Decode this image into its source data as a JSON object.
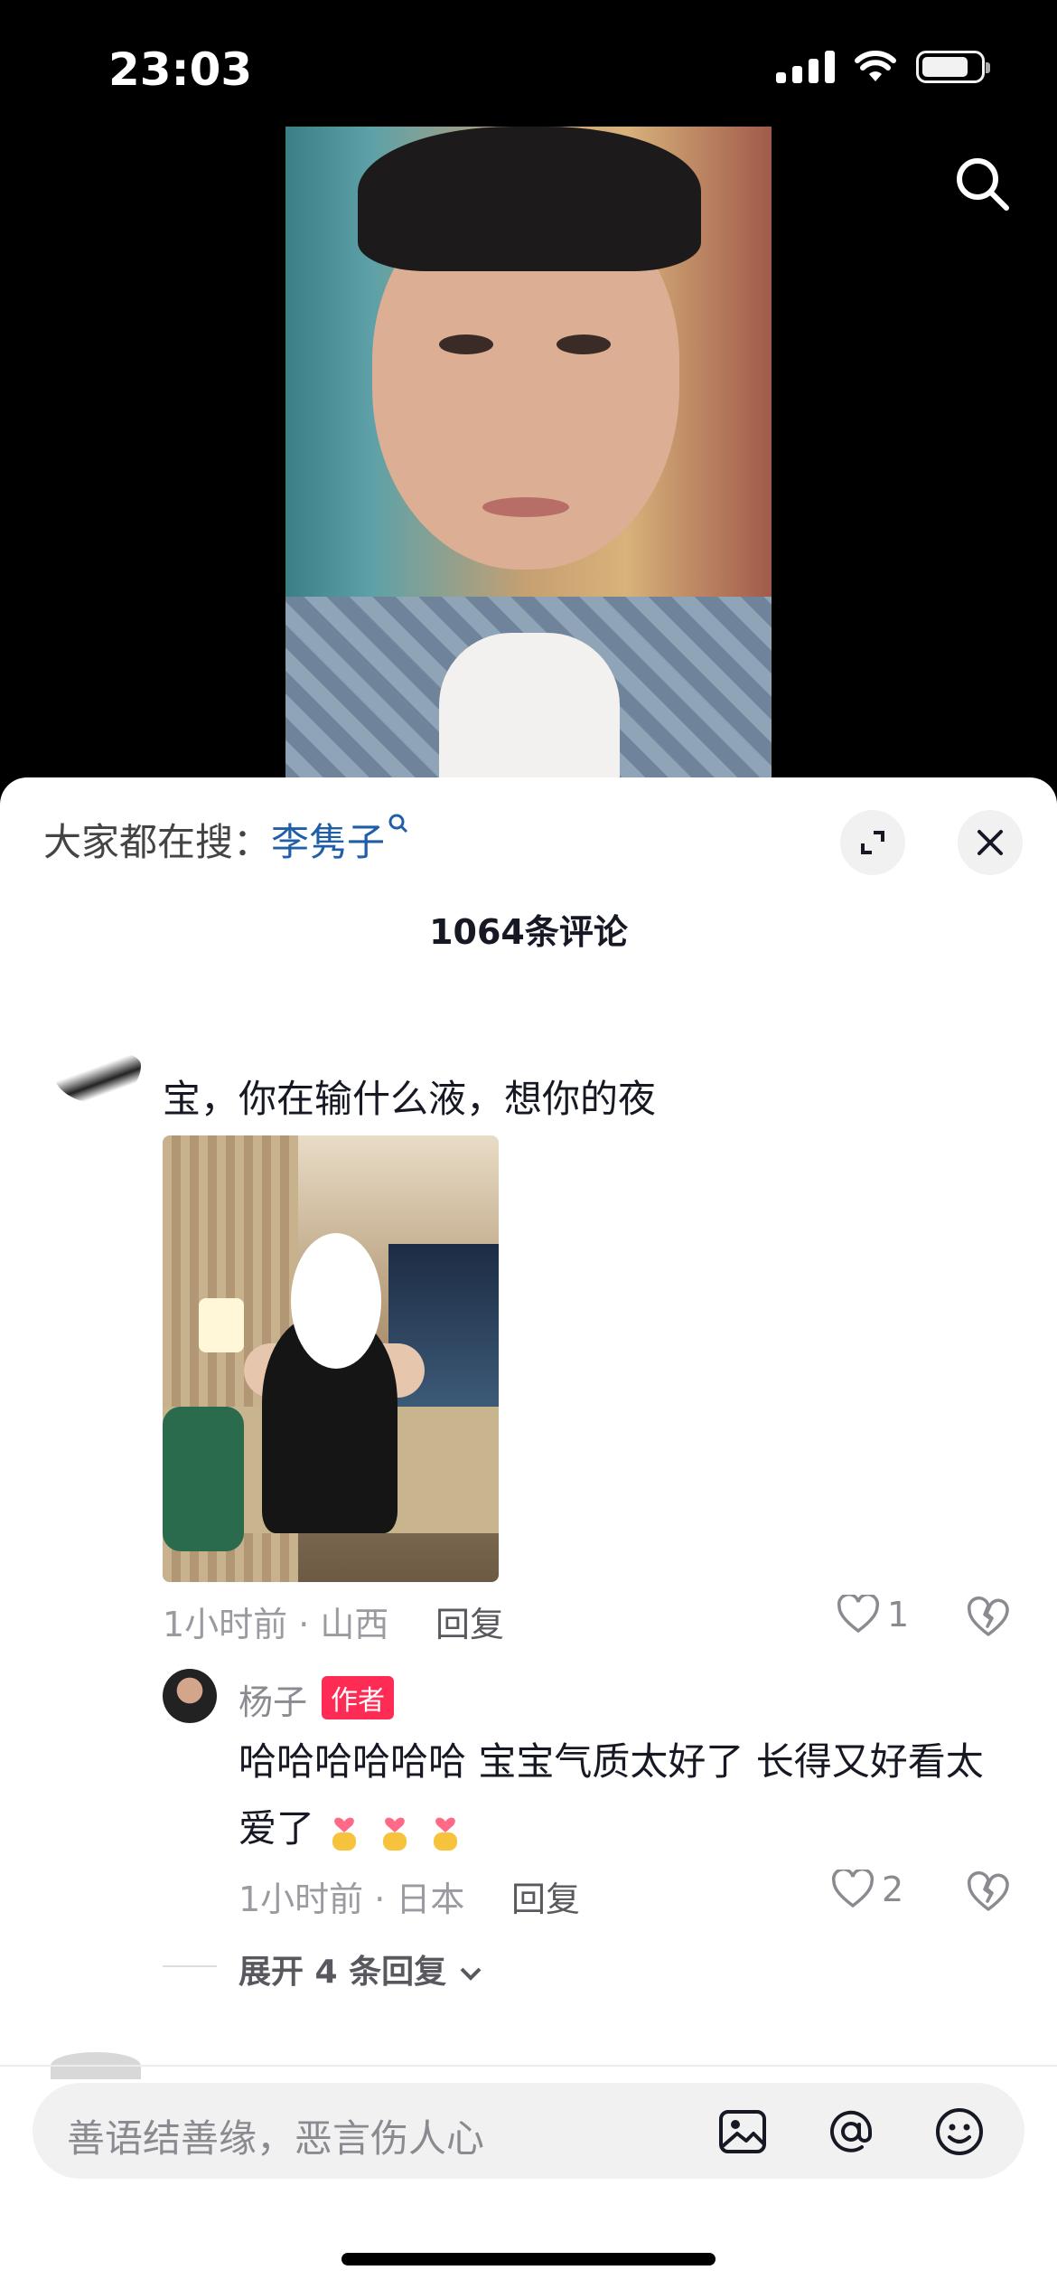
{
  "status_bar": {
    "time": "23:03"
  },
  "video": {
    "search_icon": "search-icon"
  },
  "sheet": {
    "hot_search_prefix": "大家都在搜：",
    "hot_search_keyword": "李隽子",
    "comment_count": "1064条评论",
    "comment": {
      "text": "宝，你在输什么液，想你的夜",
      "time_location": "1小时前 · 山西",
      "reply_label": "回复",
      "likes": "1"
    },
    "sub_reply": {
      "name": "杨子",
      "badge": "作者",
      "text": "哈哈哈哈哈哈 宝宝气质太好了 长得又好看太爱了",
      "time_location": "1小时前 · 日本",
      "reply_label": "回复",
      "likes": "2"
    },
    "expand_label": "展开 4 条回复"
  },
  "input": {
    "placeholder": "善语结善缘，恶言伤人心"
  },
  "colors": {
    "accent": "#fe2c55",
    "link": "#1f5fa8"
  }
}
